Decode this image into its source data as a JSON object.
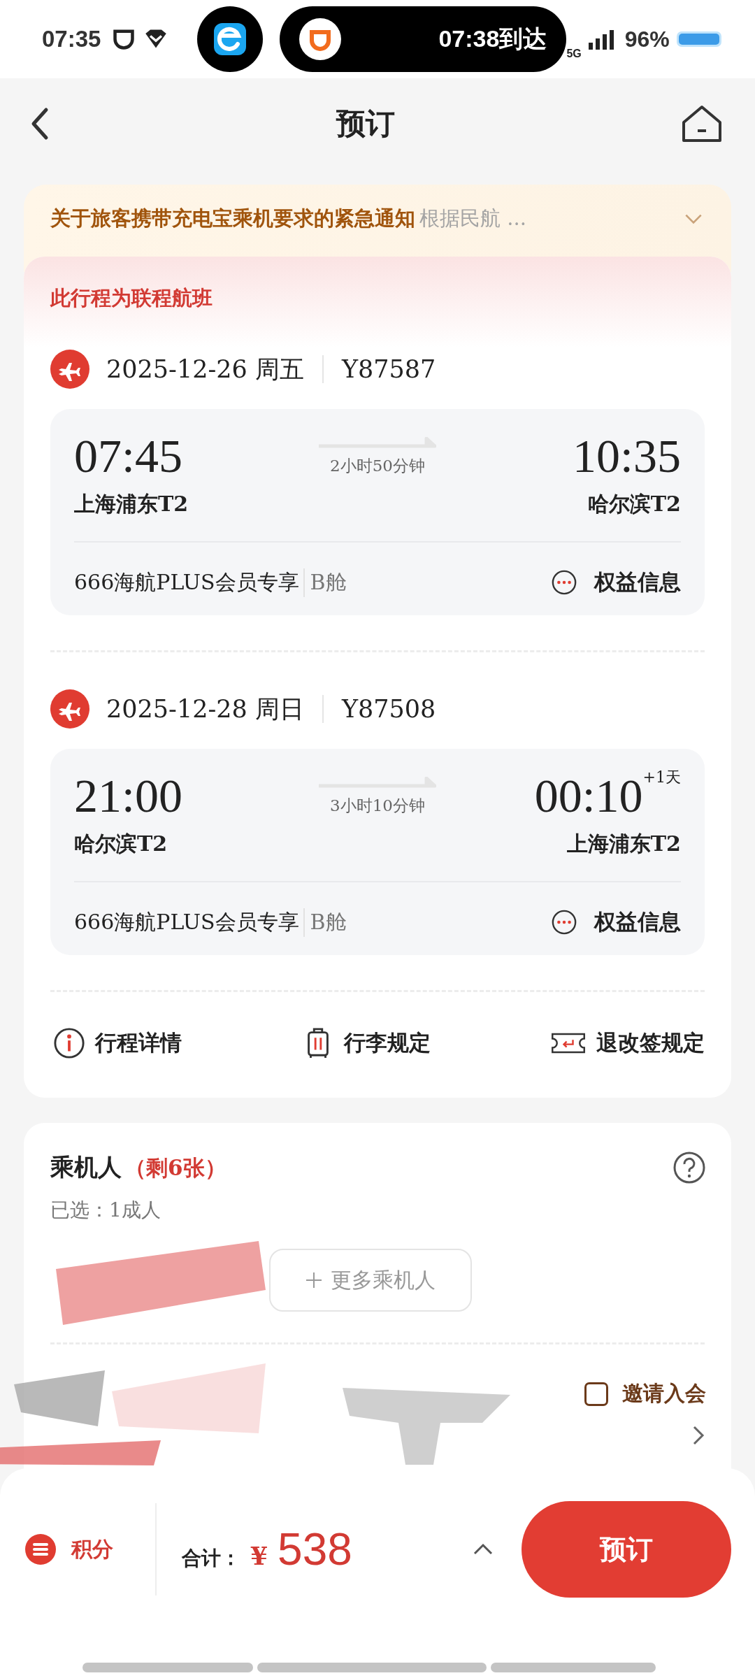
{
  "status_bar": {
    "time": "07:35",
    "arrival": "07:38到达",
    "network": "5G",
    "battery": "96%"
  },
  "nav": {
    "title": "预订"
  },
  "notice": {
    "title": "关于旅客携带充电宝乘机要求的紧急通知",
    "preview": "根据民航 ..."
  },
  "connect_banner": "此行程为联程航班",
  "segments": [
    {
      "date": "2025-12-26 周五",
      "flight_no": "Y87587",
      "depart_time": "07:45",
      "depart_airport": "上海浦东T2",
      "duration": "2小时50分钟",
      "arrive_time": "10:35",
      "arrive_airport": "哈尔滨T2",
      "fare_name": "666海航PLUS会员专享",
      "cabin": "B舱",
      "benefits": "权益信息"
    },
    {
      "date": "2025-12-28 周日",
      "flight_no": "Y87508",
      "depart_time": "21:00",
      "depart_airport": "哈尔滨T2",
      "duration": "3小时10分钟",
      "arrive_time": "00:10",
      "day_offset": "+1天",
      "arrive_airport": "上海浦东T2",
      "fare_name": "666海航PLUS会员专享",
      "cabin": "B舱",
      "benefits": "权益信息"
    }
  ],
  "links": [
    {
      "kind": "info",
      "label": "行程详情"
    },
    {
      "kind": "baggage",
      "label": "行李规定"
    },
    {
      "kind": "refund",
      "label": "退改签规定"
    }
  ],
  "passengers": {
    "title": "乘机人",
    "remaining": "（剩6张）",
    "selected_count": "已选：1成人",
    "add_button": "更多乘机人",
    "invite": {
      "label": "邀请入会",
      "checked": false
    }
  },
  "bottom_bar": {
    "points": "积分",
    "total_label": "合计：",
    "currency": "¥",
    "amount": "538",
    "book_button": "预订"
  }
}
